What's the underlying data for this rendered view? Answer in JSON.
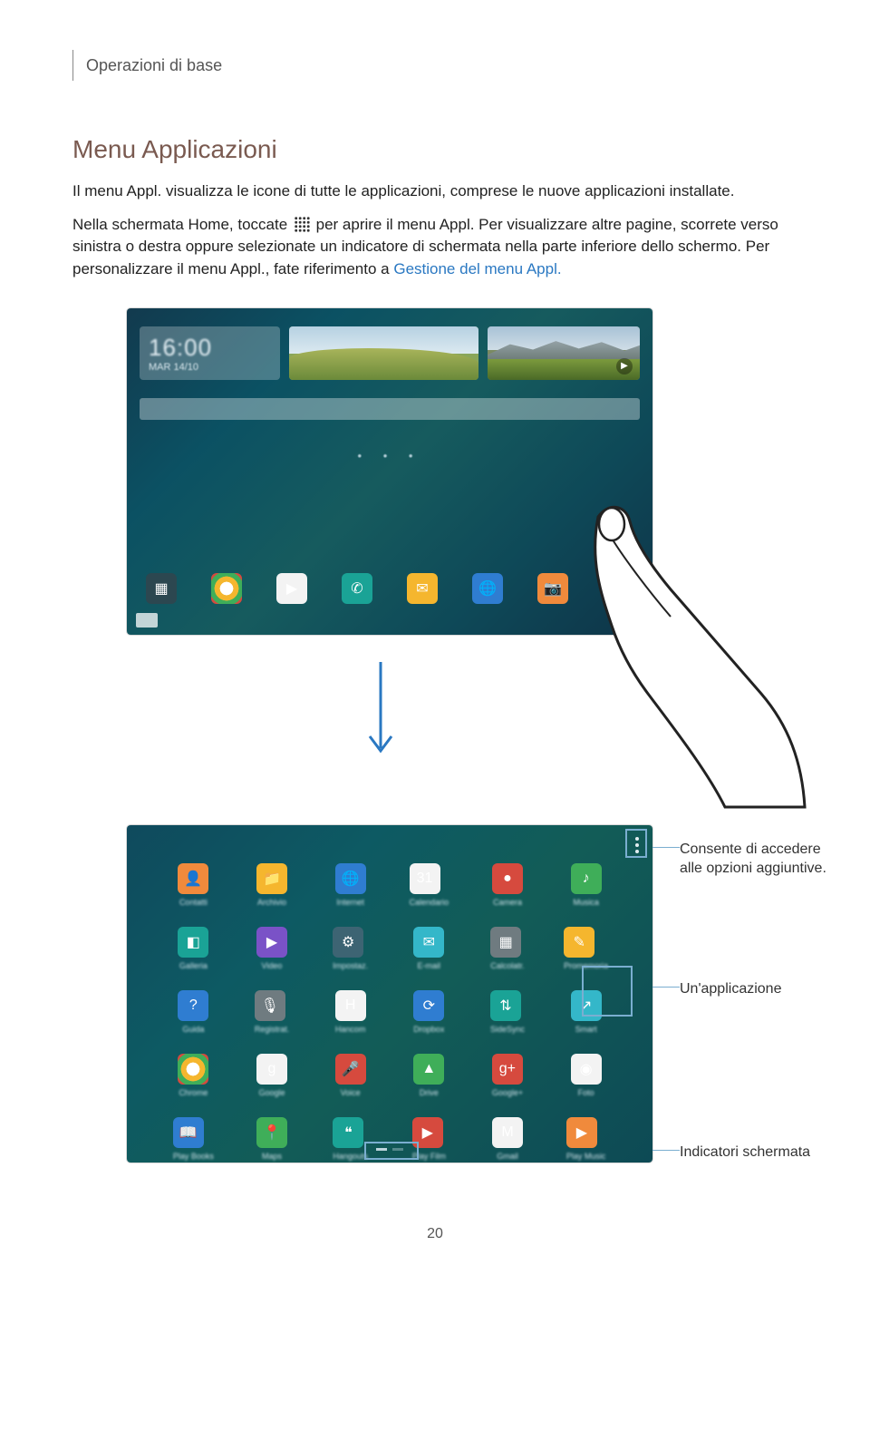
{
  "header": {
    "breadcrumb": "Operazioni di base"
  },
  "section": {
    "title": "Menu Applicazioni",
    "para1_a": "Il menu Appl. visualizza le icone di tutte le applicazioni, comprese le nuove applicazioni installate.",
    "para2_a": "Nella schermata Home, toccate ",
    "para2_b": " per aprire il menu Appl. Per visualizzare altre pagine, scorrete verso sinistra o destra oppure selezionate un indicatore di schermata nella parte inferiore dello schermo. Per personalizzare il menu Appl., fate riferimento a ",
    "para2_link": "Gestione del menu Appl.",
    "para2_c": ""
  },
  "home_widget": {
    "clock_time": "16:00",
    "clock_date": "MAR 14/10"
  },
  "callouts": {
    "options": "Consente di accedere alle opzioni aggiuntive.",
    "app": "Un'applicazione",
    "indicator": "Indicatori schermata"
  },
  "apps_grid": [
    "Contatti",
    "Archivio",
    "Internet",
    "Calendario",
    "Camera",
    "Musica",
    "Galleria",
    "Video",
    "Impostaz.",
    "E-mail",
    "Calcolatr.",
    "Promemoria",
    "Guida",
    "Registrat.",
    "Hancom",
    "Dropbox",
    "SideSync",
    "Smart",
    "Chrome",
    "Google",
    "Voice",
    "Drive",
    "Google+",
    "Foto",
    "Play Books",
    "Maps",
    "Hangouts",
    "Play Film",
    "Gmail",
    "Play Music"
  ],
  "page_number": "20"
}
